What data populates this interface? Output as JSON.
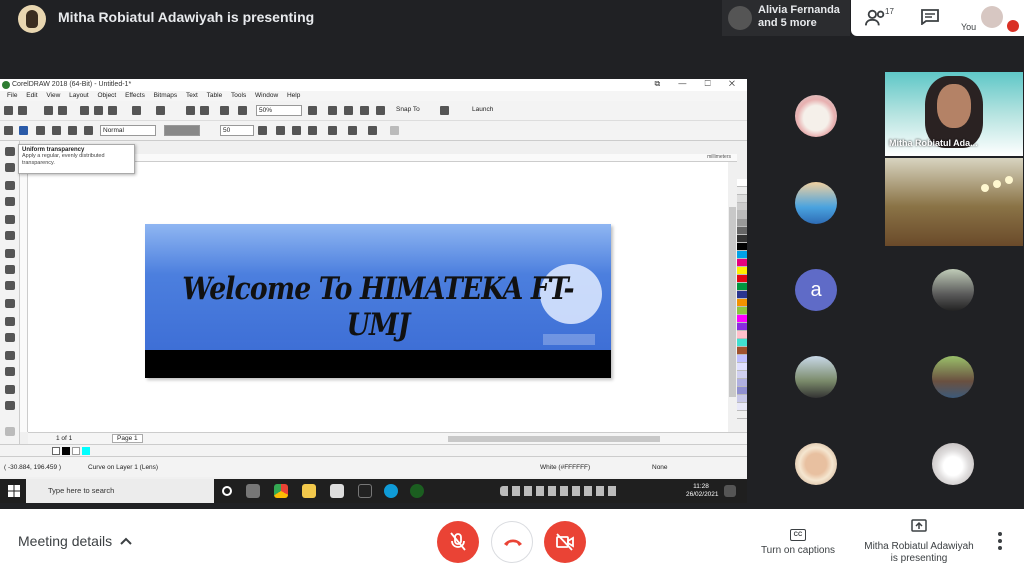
{
  "meet": {
    "presenting_title": "Mitha Robiatul Adawiyah is presenting",
    "others_line1": "Alivia Fernanda",
    "others_line2": "and 5 more",
    "people_count": "17",
    "you_label": "You",
    "featured_name": "Mitha Robiatul Ada...",
    "avatar_letter": "a",
    "meeting_details": "Meeting details",
    "turn_on_captions": "Turn on captions",
    "presenter_line1": "Mitha Robiatul Adawiyah",
    "presenter_line2": "is presenting",
    "captions_glyph": "CC",
    "colors": {
      "danger": "#ea4335",
      "bg": "#202124",
      "avatar_bg": "#5f6bc7"
    },
    "icons": [
      "people-icon",
      "chat-icon",
      "mic-off-icon",
      "hang-up-icon",
      "camera-off-icon",
      "captions-icon",
      "present-icon",
      "more-vert-icon",
      "chevron-up-icon"
    ]
  },
  "corel": {
    "window_title": "CorelDRAW 2018 (64-Bit) - Untitled-1*",
    "menu": [
      "File",
      "Edit",
      "View",
      "Layout",
      "Object",
      "Effects",
      "Bitmaps",
      "Text",
      "Table",
      "Tools",
      "Window",
      "Help"
    ],
    "zoom": "50%",
    "snap_to": "Snap To",
    "launch": "Launch",
    "merge_mode": "Normal",
    "transparency_value": "50",
    "tooltip_title": "Uniform transparency",
    "tooltip_body": "Apply a regular, evenly distributed transparency.",
    "ruler_unit": "millimeters",
    "banner_text": "Welcome To HIMATEKA FT-UMJ",
    "page_counter": "1 of 1",
    "page_tab": "Page 1",
    "cursor_coords": "( -30.884, 196.459 )",
    "status_object": "Curve on Layer 1 (Lens)",
    "fill_label": "White (#FFFFFF)",
    "outline_label": "None"
  },
  "taskbar": {
    "search_placeholder": "Type here to search",
    "time": "11:28",
    "date": "26/02/2021"
  }
}
